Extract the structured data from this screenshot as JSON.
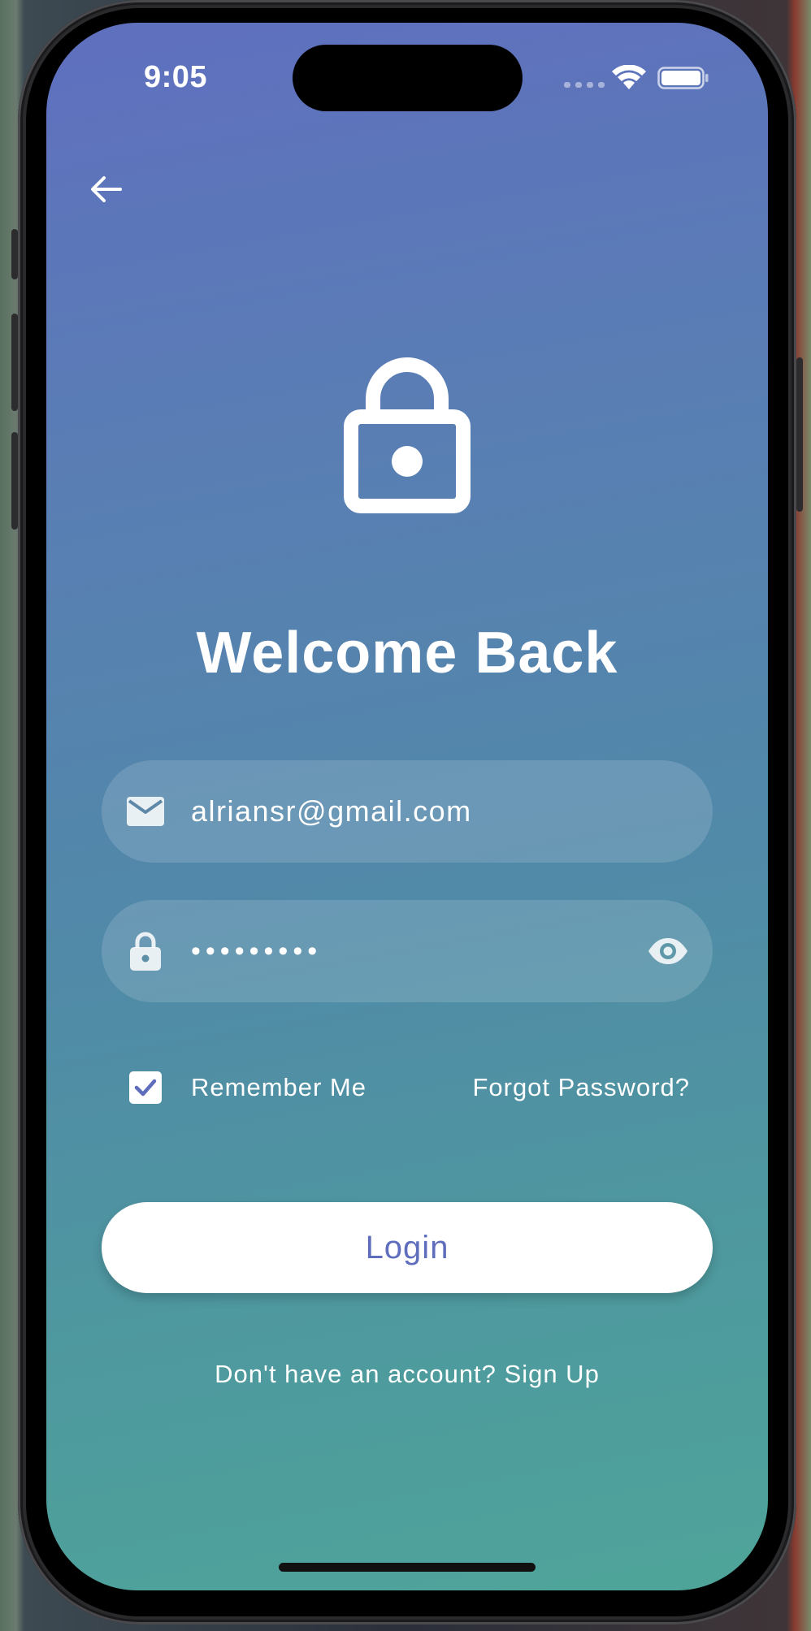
{
  "status_bar": {
    "time": "9:05"
  },
  "nav": {
    "back_icon": "arrow-left-icon"
  },
  "hero": {
    "icon": "lock-icon",
    "title": "Welcome Back"
  },
  "form": {
    "email": {
      "icon": "mail-icon",
      "value": "alriansr@gmail.com"
    },
    "password": {
      "icon": "lock-icon",
      "value": "•••••••••",
      "toggle_icon": "eye-icon"
    },
    "remember_me": {
      "label": "Remember Me",
      "checked": true
    },
    "forgot_password": "Forgot Password?",
    "login_label": "Login",
    "signup_prompt": "Don't have an account? Sign Up"
  },
  "colors": {
    "gradient_top": "#5f6fbf",
    "gradient_bottom": "#4fa59a",
    "accent": "#5f6dbd",
    "field_background": "rgba(255,255,255,0.14)"
  }
}
